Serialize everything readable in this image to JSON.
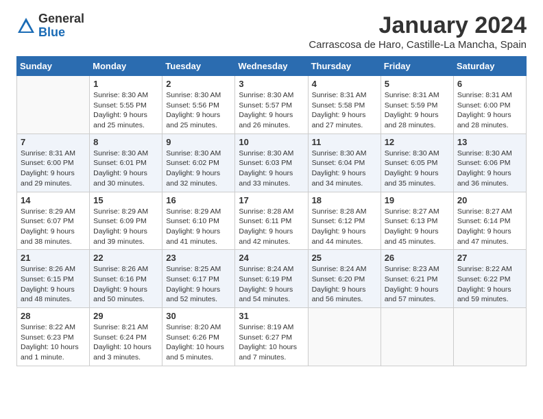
{
  "logo": {
    "general": "General",
    "blue": "Blue"
  },
  "title": "January 2024",
  "location": "Carrascosa de Haro, Castille-La Mancha, Spain",
  "days_of_week": [
    "Sunday",
    "Monday",
    "Tuesday",
    "Wednesday",
    "Thursday",
    "Friday",
    "Saturday"
  ],
  "weeks": [
    [
      {
        "day": "",
        "content": ""
      },
      {
        "day": "1",
        "content": "Sunrise: 8:30 AM\nSunset: 5:55 PM\nDaylight: 9 hours\nand 25 minutes."
      },
      {
        "day": "2",
        "content": "Sunrise: 8:30 AM\nSunset: 5:56 PM\nDaylight: 9 hours\nand 25 minutes."
      },
      {
        "day": "3",
        "content": "Sunrise: 8:30 AM\nSunset: 5:57 PM\nDaylight: 9 hours\nand 26 minutes."
      },
      {
        "day": "4",
        "content": "Sunrise: 8:31 AM\nSunset: 5:58 PM\nDaylight: 9 hours\nand 27 minutes."
      },
      {
        "day": "5",
        "content": "Sunrise: 8:31 AM\nSunset: 5:59 PM\nDaylight: 9 hours\nand 28 minutes."
      },
      {
        "day": "6",
        "content": "Sunrise: 8:31 AM\nSunset: 6:00 PM\nDaylight: 9 hours\nand 28 minutes."
      }
    ],
    [
      {
        "day": "7",
        "content": "Sunrise: 8:31 AM\nSunset: 6:00 PM\nDaylight: 9 hours\nand 29 minutes."
      },
      {
        "day": "8",
        "content": "Sunrise: 8:30 AM\nSunset: 6:01 PM\nDaylight: 9 hours\nand 30 minutes."
      },
      {
        "day": "9",
        "content": "Sunrise: 8:30 AM\nSunset: 6:02 PM\nDaylight: 9 hours\nand 32 minutes."
      },
      {
        "day": "10",
        "content": "Sunrise: 8:30 AM\nSunset: 6:03 PM\nDaylight: 9 hours\nand 33 minutes."
      },
      {
        "day": "11",
        "content": "Sunrise: 8:30 AM\nSunset: 6:04 PM\nDaylight: 9 hours\nand 34 minutes."
      },
      {
        "day": "12",
        "content": "Sunrise: 8:30 AM\nSunset: 6:05 PM\nDaylight: 9 hours\nand 35 minutes."
      },
      {
        "day": "13",
        "content": "Sunrise: 8:30 AM\nSunset: 6:06 PM\nDaylight: 9 hours\nand 36 minutes."
      }
    ],
    [
      {
        "day": "14",
        "content": "Sunrise: 8:29 AM\nSunset: 6:07 PM\nDaylight: 9 hours\nand 38 minutes."
      },
      {
        "day": "15",
        "content": "Sunrise: 8:29 AM\nSunset: 6:09 PM\nDaylight: 9 hours\nand 39 minutes."
      },
      {
        "day": "16",
        "content": "Sunrise: 8:29 AM\nSunset: 6:10 PM\nDaylight: 9 hours\nand 41 minutes."
      },
      {
        "day": "17",
        "content": "Sunrise: 8:28 AM\nSunset: 6:11 PM\nDaylight: 9 hours\nand 42 minutes."
      },
      {
        "day": "18",
        "content": "Sunrise: 8:28 AM\nSunset: 6:12 PM\nDaylight: 9 hours\nand 44 minutes."
      },
      {
        "day": "19",
        "content": "Sunrise: 8:27 AM\nSunset: 6:13 PM\nDaylight: 9 hours\nand 45 minutes."
      },
      {
        "day": "20",
        "content": "Sunrise: 8:27 AM\nSunset: 6:14 PM\nDaylight: 9 hours\nand 47 minutes."
      }
    ],
    [
      {
        "day": "21",
        "content": "Sunrise: 8:26 AM\nSunset: 6:15 PM\nDaylight: 9 hours\nand 48 minutes."
      },
      {
        "day": "22",
        "content": "Sunrise: 8:26 AM\nSunset: 6:16 PM\nDaylight: 9 hours\nand 50 minutes."
      },
      {
        "day": "23",
        "content": "Sunrise: 8:25 AM\nSunset: 6:17 PM\nDaylight: 9 hours\nand 52 minutes."
      },
      {
        "day": "24",
        "content": "Sunrise: 8:24 AM\nSunset: 6:19 PM\nDaylight: 9 hours\nand 54 minutes."
      },
      {
        "day": "25",
        "content": "Sunrise: 8:24 AM\nSunset: 6:20 PM\nDaylight: 9 hours\nand 56 minutes."
      },
      {
        "day": "26",
        "content": "Sunrise: 8:23 AM\nSunset: 6:21 PM\nDaylight: 9 hours\nand 57 minutes."
      },
      {
        "day": "27",
        "content": "Sunrise: 8:22 AM\nSunset: 6:22 PM\nDaylight: 9 hours\nand 59 minutes."
      }
    ],
    [
      {
        "day": "28",
        "content": "Sunrise: 8:22 AM\nSunset: 6:23 PM\nDaylight: 10 hours\nand 1 minute."
      },
      {
        "day": "29",
        "content": "Sunrise: 8:21 AM\nSunset: 6:24 PM\nDaylight: 10 hours\nand 3 minutes."
      },
      {
        "day": "30",
        "content": "Sunrise: 8:20 AM\nSunset: 6:26 PM\nDaylight: 10 hours\nand 5 minutes."
      },
      {
        "day": "31",
        "content": "Sunrise: 8:19 AM\nSunset: 6:27 PM\nDaylight: 10 hours\nand 7 minutes."
      },
      {
        "day": "",
        "content": ""
      },
      {
        "day": "",
        "content": ""
      },
      {
        "day": "",
        "content": ""
      }
    ]
  ]
}
